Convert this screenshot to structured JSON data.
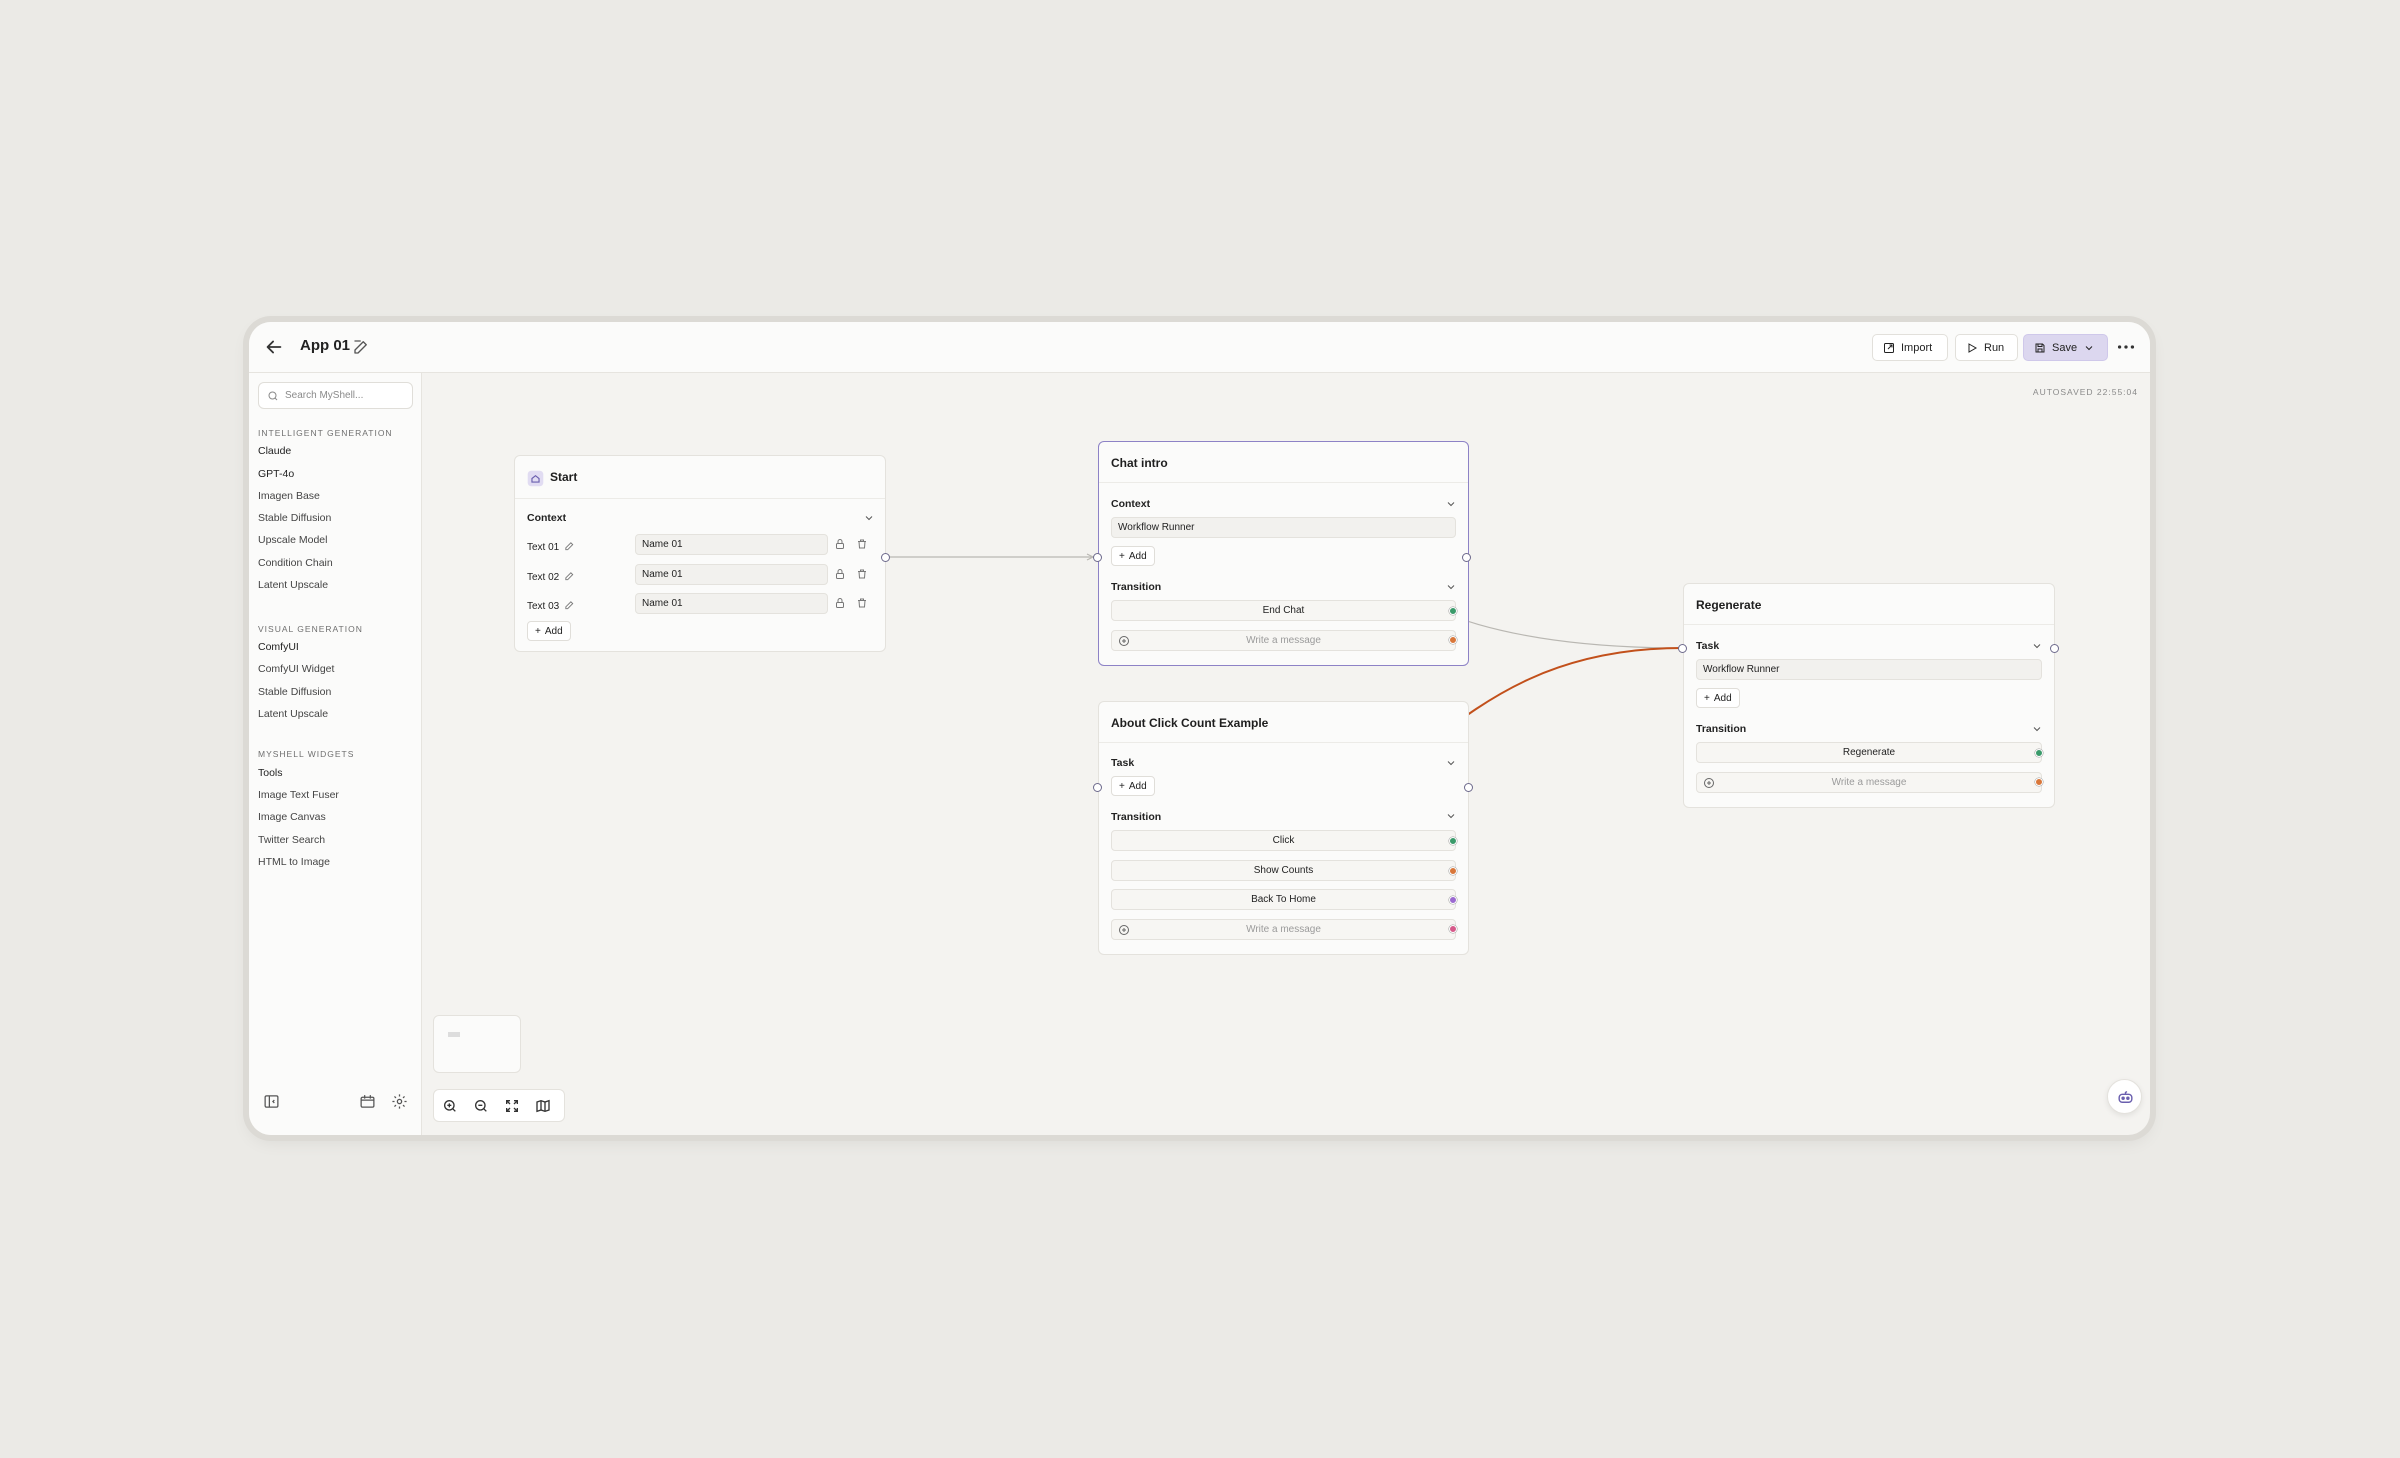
{
  "header": {
    "title": "App 01",
    "import_label": "Import",
    "run_label": "Run",
    "save_label": "Save"
  },
  "sidebar": {
    "search_placeholder": "Search MyShell...",
    "sections": [
      {
        "title": "INTELLIGENT GENERATION",
        "items": [
          "Claude",
          "GPT-4o",
          "Imagen Base",
          "Stable Diffusion",
          "Upscale Model",
          "Condition Chain",
          "Latent Upscale"
        ]
      },
      {
        "title": "VISUAL GENERATION",
        "items": [
          "ComfyUI",
          "ComfyUI Widget",
          "Stable Diffusion",
          "Latent Upscale"
        ]
      },
      {
        "title": "MYSHELL WIDGETS",
        "items": [
          "Tools",
          "Image Text Fuser",
          "Image Canvas",
          "Twitter Search",
          "HTML to Image"
        ]
      }
    ]
  },
  "canvas": {
    "autosaved": "AUTOSAVED 22:55:04",
    "start": {
      "title": "Start",
      "context_label": "Context",
      "rows": [
        {
          "label": "Text 01",
          "value": "Name 01"
        },
        {
          "label": "Text 02",
          "value": "Name 01"
        },
        {
          "label": "Text 03",
          "value": "Name 01"
        }
      ],
      "add_label": "Add"
    },
    "chat_intro": {
      "title": "Chat intro",
      "context_label": "Context",
      "context_value": "Workflow Runner",
      "add_label": "Add",
      "transition_label": "Transition",
      "transitions": [
        "End Chat"
      ],
      "message_placeholder": "Write a message"
    },
    "about": {
      "title": "About Click Count Example",
      "task_label": "Task",
      "add_label": "Add",
      "transition_label": "Transition",
      "transitions": [
        "Click",
        "Show Counts",
        "Back To Home"
      ],
      "message_placeholder": "Write a message"
    },
    "regenerate": {
      "title": "Regenerate",
      "task_label": "Task",
      "task_value": "Workflow Runner",
      "add_label": "Add",
      "transition_label": "Transition",
      "transitions": [
        "Regenerate"
      ],
      "message_placeholder": "Write a message"
    }
  },
  "colors": {
    "accent": "#8d82c6",
    "edge_active": "#c2501b",
    "dot_green": "#3a9a6a",
    "dot_orange": "#d9773a",
    "dot_purple": "#9b6ad0",
    "dot_pink": "#d65a8a"
  }
}
